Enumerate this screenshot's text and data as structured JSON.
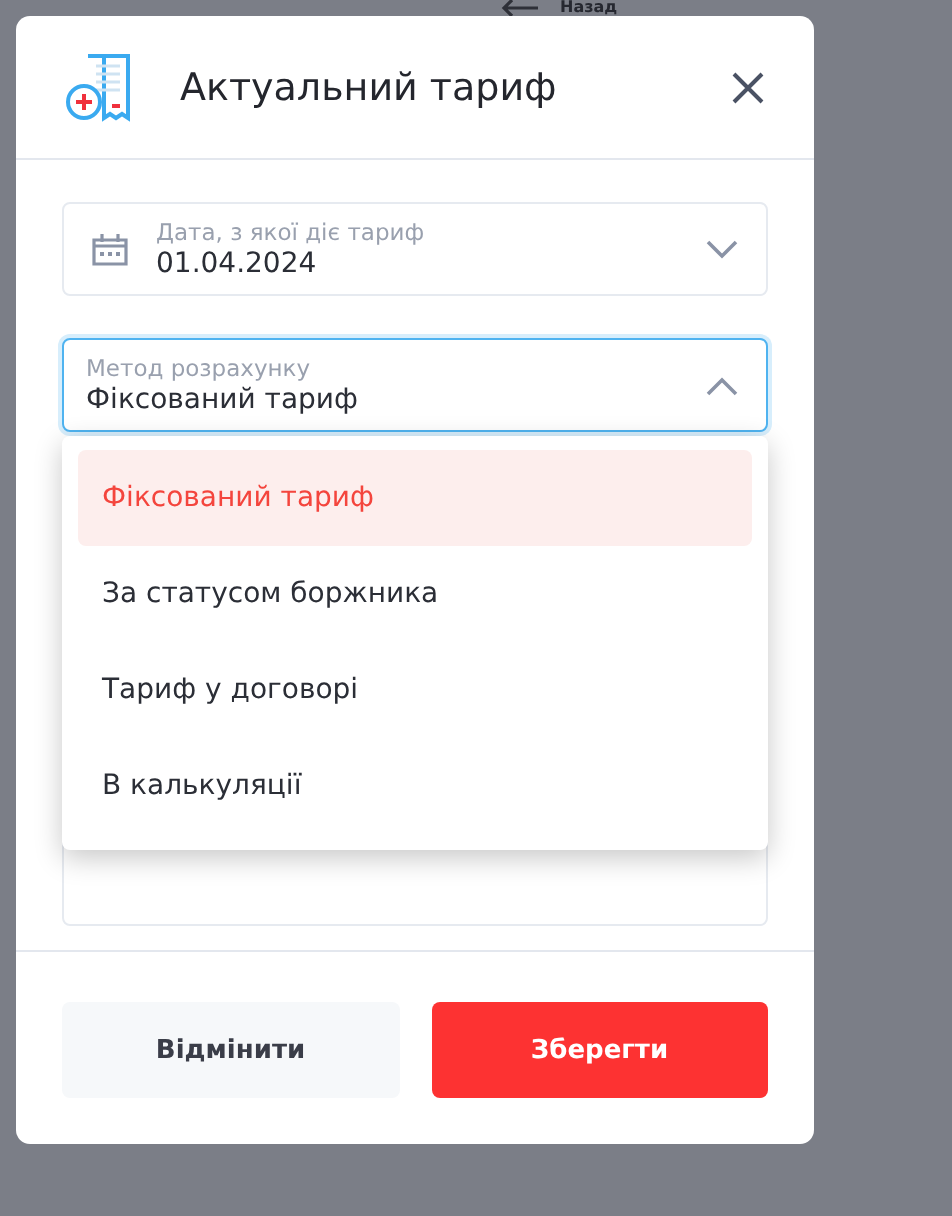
{
  "back_link": {
    "label": "Назад"
  },
  "dialog": {
    "title": "Актуальний тариф"
  },
  "fields": [
    {
      "kind": "date",
      "label": "Дата, з якої діє тариф",
      "value": "01.04.2024",
      "expanded": false
    },
    {
      "kind": "select",
      "label": "Метод розрахунку",
      "value": "Фіксований тариф",
      "expanded": true
    }
  ],
  "options": [
    {
      "label": "Фіксований тариф",
      "selected": true
    },
    {
      "label": "За статусом боржника",
      "selected": false
    },
    {
      "label": "Тариф у договорі",
      "selected": false
    },
    {
      "label": "В калькуляції",
      "selected": false
    }
  ],
  "buttons": [
    {
      "kind": "secondary",
      "label": "Відмінити"
    },
    {
      "kind": "primary",
      "label": "Зберегти"
    }
  ]
}
